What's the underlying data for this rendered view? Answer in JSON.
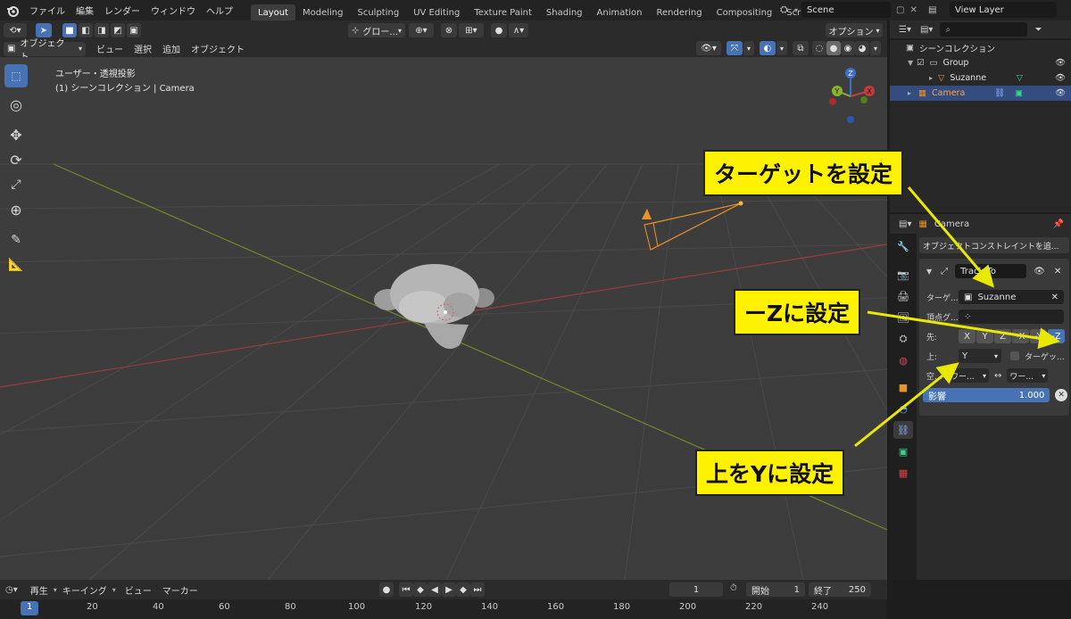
{
  "topbar": {
    "menus": [
      "ファイル",
      "編集",
      "レンダー",
      "ウィンドウ",
      "ヘルプ"
    ],
    "tabs": [
      "Layout",
      "Modeling",
      "Sculpting",
      "UV Editing",
      "Texture Paint",
      "Shading",
      "Animation",
      "Rendering",
      "Compositing",
      "Scripting"
    ],
    "scene": "Scene",
    "view_layer": "View Layer"
  },
  "view_header": {
    "mode": "オブジェクト...",
    "menus": [
      "ビュー",
      "選択",
      "追加",
      "オブジェクト"
    ],
    "transform": "グロー...",
    "options": "オプション"
  },
  "viewport": {
    "line1": "ユーザー・透視投影",
    "line2": "(1) シーンコレクション | Camera",
    "gizmo": {
      "z": "Z",
      "y": "Y",
      "x": "X"
    }
  },
  "outliner": {
    "root": "シーンコレクション",
    "items": [
      "Group",
      "Suzanne",
      "Camera"
    ]
  },
  "properties": {
    "object_name": "Camera",
    "add_constraint": "オブジェクトコンストレイントを追...",
    "constraint_name": "Track To",
    "target_label": "ターゲ...",
    "target_value": "Suzanne",
    "vgroup_label": "頂点グ...",
    "track_label": "先:",
    "axes": [
      "X",
      "Y",
      "Z",
      "-X",
      "-Y",
      "-Z"
    ],
    "up_label": "上:",
    "up_value": "Y",
    "target_z": "ターゲッ...",
    "space_label": "空...",
    "space1": "ワー...",
    "space2": "ワー...",
    "influence_label": "影響",
    "influence_value": "1.000"
  },
  "timeline": {
    "menus": [
      "再生",
      "キーイング",
      "ビュー",
      "マーカー"
    ],
    "current_frame": "1",
    "start_label": "開始",
    "start_value": "1",
    "end_label": "終了",
    "end_value": "250",
    "ticks": [
      "1",
      "20",
      "40",
      "60",
      "80",
      "100",
      "120",
      "140",
      "160",
      "180",
      "200",
      "220",
      "240"
    ]
  },
  "annotations": {
    "target": "ターゲットを設定",
    "minus_z": "ーZに設定",
    "up_y": "上をYに設定"
  },
  "colors": {
    "accent": "#4772b3",
    "callout": "#fff200",
    "arrow": "#e8e800",
    "camera": "#e8922c"
  }
}
